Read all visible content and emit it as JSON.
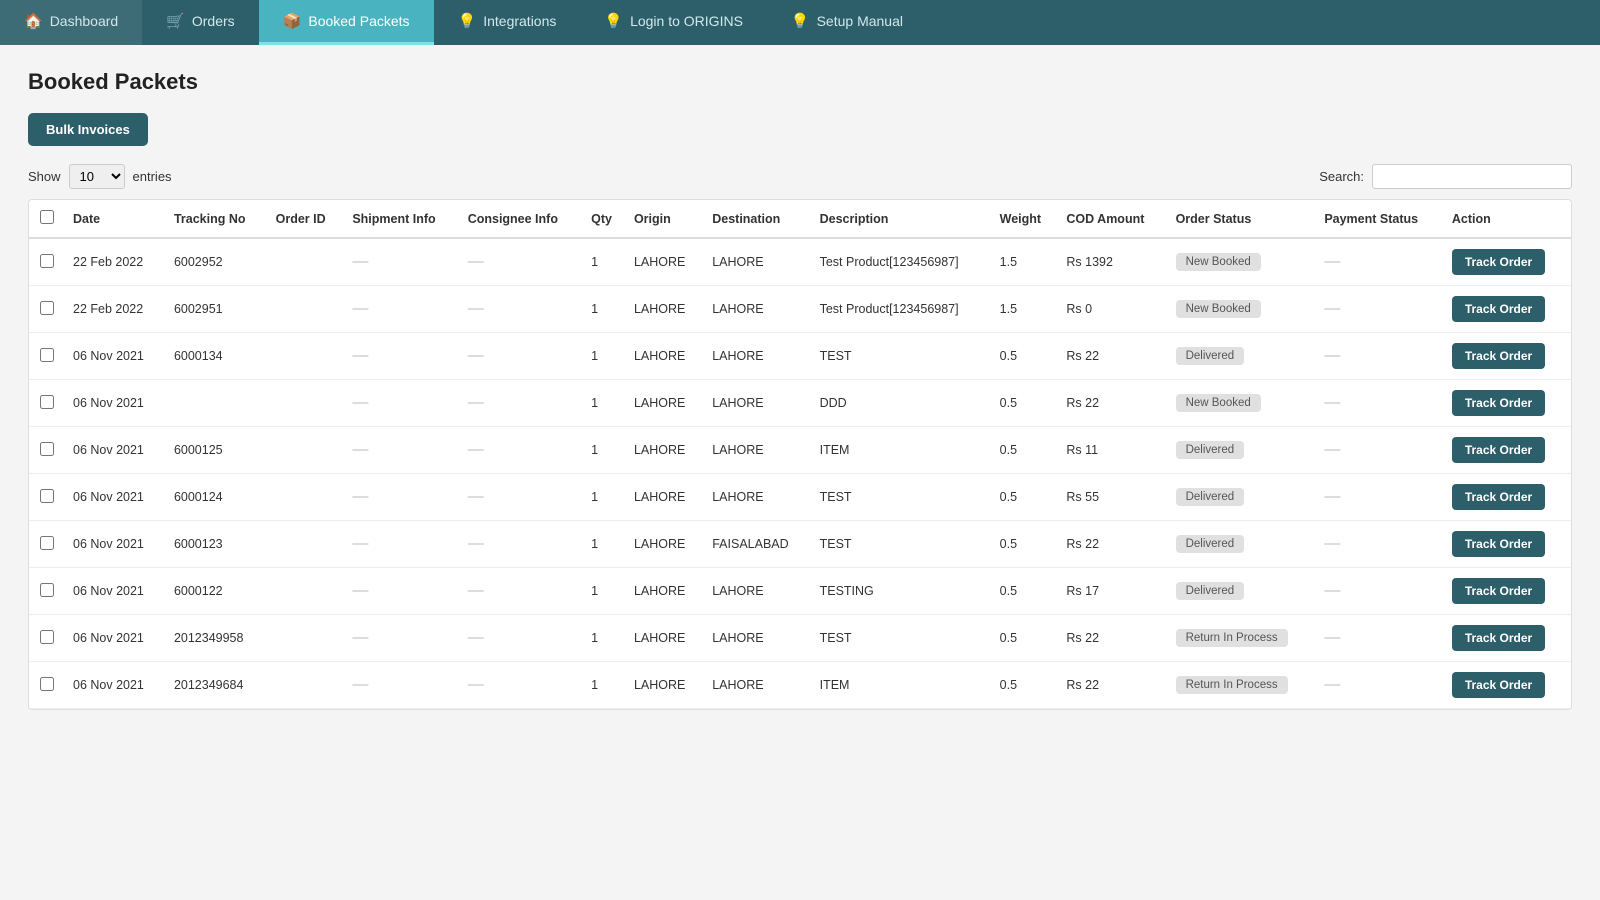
{
  "nav": {
    "items": [
      {
        "id": "dashboard",
        "label": "Dashboard",
        "icon": "🏠",
        "active": false
      },
      {
        "id": "orders",
        "label": "Orders",
        "icon": "🛒",
        "active": false
      },
      {
        "id": "booked-packets",
        "label": "Booked Packets",
        "icon": "📦",
        "active": true
      },
      {
        "id": "integrations",
        "label": "Integrations",
        "icon": "💡",
        "active": false
      },
      {
        "id": "login-origins",
        "label": "Login to ORIGINS",
        "icon": "💡",
        "active": false
      },
      {
        "id": "setup-manual",
        "label": "Setup Manual",
        "icon": "💡",
        "active": false
      }
    ]
  },
  "page": {
    "title": "Booked Packets",
    "bulk_invoices_label": "Bulk Invoices",
    "show_label": "Show",
    "entries_label": "entries",
    "show_value": "10",
    "search_label": "Search:",
    "search_placeholder": ""
  },
  "table": {
    "columns": [
      "",
      "Date",
      "Tracking No",
      "Order ID",
      "Shipment Info",
      "Consignee Info",
      "Qty",
      "Origin",
      "Destination",
      "Description",
      "Weight",
      "COD Amount",
      "Order Status",
      "Payment Status",
      "Action"
    ],
    "rows": [
      {
        "date": "22 Feb 2022",
        "tracking": "6002952",
        "order_id": "",
        "qty": "1",
        "origin": "LAHORE",
        "destination": "LAHORE",
        "description": "Test Product[123456987]",
        "weight": "1.5",
        "cod": "Rs 1392",
        "order_status": "New Booked",
        "payment_status": "",
        "action": "Track Order"
      },
      {
        "date": "22 Feb 2022",
        "tracking": "6002951",
        "order_id": "",
        "qty": "1",
        "origin": "LAHORE",
        "destination": "LAHORE",
        "description": "Test Product[123456987]",
        "weight": "1.5",
        "cod": "Rs 0",
        "order_status": "New Booked",
        "payment_status": "",
        "action": "Track Order"
      },
      {
        "date": "06 Nov 2021",
        "tracking": "6000134",
        "order_id": "",
        "qty": "1",
        "origin": "LAHORE",
        "destination": "LAHORE",
        "description": "TEST",
        "weight": "0.5",
        "cod": "Rs 22",
        "order_status": "Delivered",
        "payment_status": "",
        "action": "Track Order"
      },
      {
        "date": "06 Nov 2021",
        "tracking": "",
        "order_id": "",
        "qty": "1",
        "origin": "LAHORE",
        "destination": "LAHORE",
        "description": "DDD",
        "weight": "0.5",
        "cod": "Rs 22",
        "order_status": "New Booked",
        "payment_status": "",
        "action": "Track Order"
      },
      {
        "date": "06 Nov 2021",
        "tracking": "6000125",
        "order_id": "",
        "qty": "1",
        "origin": "LAHORE",
        "destination": "LAHORE",
        "description": "ITEM",
        "weight": "0.5",
        "cod": "Rs 11",
        "order_status": "Delivered",
        "payment_status": "",
        "action": "Track Order"
      },
      {
        "date": "06 Nov 2021",
        "tracking": "6000124",
        "order_id": "",
        "qty": "1",
        "origin": "LAHORE",
        "destination": "LAHORE",
        "description": "TEST",
        "weight": "0.5",
        "cod": "Rs 55",
        "order_status": "Delivered",
        "payment_status": "",
        "action": "Track Order"
      },
      {
        "date": "06 Nov 2021",
        "tracking": "6000123",
        "order_id": "",
        "qty": "1",
        "origin": "LAHORE",
        "destination": "FAISALABAD",
        "description": "TEST",
        "weight": "0.5",
        "cod": "Rs 22",
        "order_status": "Delivered",
        "payment_status": "",
        "action": "Track Order"
      },
      {
        "date": "06 Nov 2021",
        "tracking": "6000122",
        "order_id": "",
        "qty": "1",
        "origin": "LAHORE",
        "destination": "LAHORE",
        "description": "TESTING",
        "weight": "0.5",
        "cod": "Rs 17",
        "order_status": "Delivered",
        "payment_status": "",
        "action": "Track Order"
      },
      {
        "date": "06 Nov 2021",
        "tracking": "2012349958",
        "order_id": "",
        "qty": "1",
        "origin": "LAHORE",
        "destination": "LAHORE",
        "description": "TEST",
        "weight": "0.5",
        "cod": "Rs 22",
        "order_status": "Return In Process",
        "payment_status": "",
        "action": "Track Order"
      },
      {
        "date": "06 Nov 2021",
        "tracking": "2012349684",
        "order_id": "",
        "qty": "1",
        "origin": "LAHORE",
        "destination": "LAHORE",
        "description": "ITEM",
        "weight": "0.5",
        "cod": "Rs 22",
        "order_status": "Return In Process",
        "payment_status": "",
        "action": "Track Order"
      }
    ]
  },
  "status_badge_classes": {
    "New Booked": "badge-new-booked",
    "Delivered": "badge-delivered",
    "Return In Process": "badge-return"
  }
}
